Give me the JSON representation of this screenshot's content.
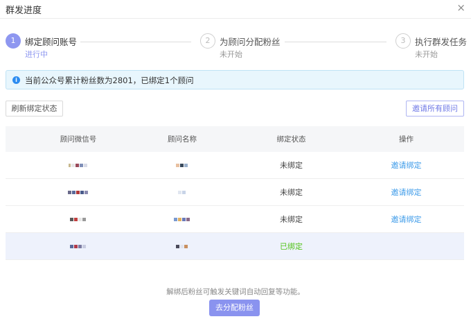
{
  "dialog": {
    "title": "群发进度",
    "close_icon": "×"
  },
  "steps": [
    {
      "index": "1",
      "title": "绑定顾问账号",
      "status": "进行中"
    },
    {
      "index": "2",
      "title": "为顾问分配粉丝",
      "status": "未开始"
    },
    {
      "index": "3",
      "title": "执行群发任务",
      "status": "未开始"
    }
  ],
  "info": {
    "icon": "info-icon",
    "text": "当前公众号累计粉丝数为2801，已绑定1个顾问"
  },
  "toolbar": {
    "refresh_label": "刷新绑定状态",
    "invite_all_label": "邀请所有顾问"
  },
  "table": {
    "headers": [
      "顾问微信号",
      "顾问名称",
      "绑定状态",
      "操作"
    ],
    "rows": [
      {
        "status": "未绑定",
        "action": "邀请绑定"
      },
      {
        "status": "未绑定",
        "action": "邀请绑定"
      },
      {
        "status": "未绑定",
        "action": "邀请绑定"
      },
      {
        "status": "已绑定",
        "action": ""
      }
    ]
  },
  "footer": {
    "note": "解绑后粉丝可触发关键词自动回复等功能。",
    "assign_label": "去分配粉丝"
  },
  "colors": {
    "accent": "#8e97f0",
    "link": "#3d9be9",
    "bound": "#52c41a",
    "info_bg": "#e8f6fd"
  }
}
